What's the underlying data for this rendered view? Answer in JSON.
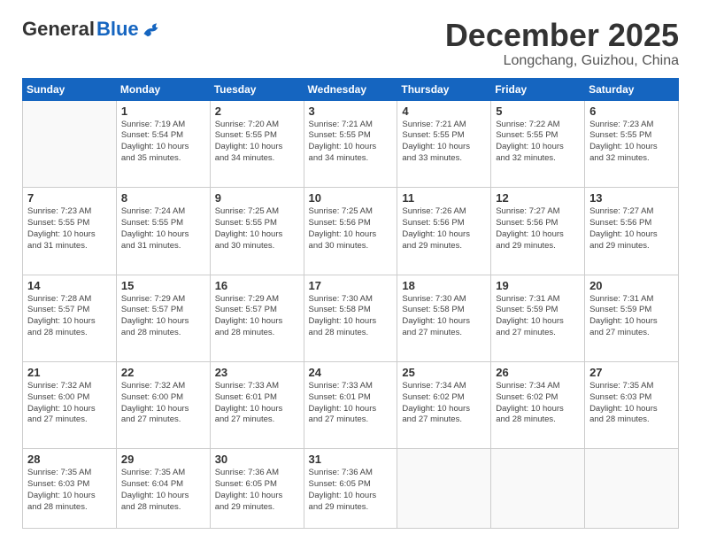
{
  "header": {
    "logo_general": "General",
    "logo_blue": "Blue",
    "month": "December 2025",
    "location": "Longchang, Guizhou, China"
  },
  "days_of_week": [
    "Sunday",
    "Monday",
    "Tuesday",
    "Wednesday",
    "Thursday",
    "Friday",
    "Saturday"
  ],
  "weeks": [
    [
      {
        "day": "",
        "info": ""
      },
      {
        "day": "1",
        "info": "Sunrise: 7:19 AM\nSunset: 5:54 PM\nDaylight: 10 hours\nand 35 minutes."
      },
      {
        "day": "2",
        "info": "Sunrise: 7:20 AM\nSunset: 5:55 PM\nDaylight: 10 hours\nand 34 minutes."
      },
      {
        "day": "3",
        "info": "Sunrise: 7:21 AM\nSunset: 5:55 PM\nDaylight: 10 hours\nand 34 minutes."
      },
      {
        "day": "4",
        "info": "Sunrise: 7:21 AM\nSunset: 5:55 PM\nDaylight: 10 hours\nand 33 minutes."
      },
      {
        "day": "5",
        "info": "Sunrise: 7:22 AM\nSunset: 5:55 PM\nDaylight: 10 hours\nand 32 minutes."
      },
      {
        "day": "6",
        "info": "Sunrise: 7:23 AM\nSunset: 5:55 PM\nDaylight: 10 hours\nand 32 minutes."
      }
    ],
    [
      {
        "day": "7",
        "info": "Sunrise: 7:23 AM\nSunset: 5:55 PM\nDaylight: 10 hours\nand 31 minutes."
      },
      {
        "day": "8",
        "info": "Sunrise: 7:24 AM\nSunset: 5:55 PM\nDaylight: 10 hours\nand 31 minutes."
      },
      {
        "day": "9",
        "info": "Sunrise: 7:25 AM\nSunset: 5:55 PM\nDaylight: 10 hours\nand 30 minutes."
      },
      {
        "day": "10",
        "info": "Sunrise: 7:25 AM\nSunset: 5:56 PM\nDaylight: 10 hours\nand 30 minutes."
      },
      {
        "day": "11",
        "info": "Sunrise: 7:26 AM\nSunset: 5:56 PM\nDaylight: 10 hours\nand 29 minutes."
      },
      {
        "day": "12",
        "info": "Sunrise: 7:27 AM\nSunset: 5:56 PM\nDaylight: 10 hours\nand 29 minutes."
      },
      {
        "day": "13",
        "info": "Sunrise: 7:27 AM\nSunset: 5:56 PM\nDaylight: 10 hours\nand 29 minutes."
      }
    ],
    [
      {
        "day": "14",
        "info": "Sunrise: 7:28 AM\nSunset: 5:57 PM\nDaylight: 10 hours\nand 28 minutes."
      },
      {
        "day": "15",
        "info": "Sunrise: 7:29 AM\nSunset: 5:57 PM\nDaylight: 10 hours\nand 28 minutes."
      },
      {
        "day": "16",
        "info": "Sunrise: 7:29 AM\nSunset: 5:57 PM\nDaylight: 10 hours\nand 28 minutes."
      },
      {
        "day": "17",
        "info": "Sunrise: 7:30 AM\nSunset: 5:58 PM\nDaylight: 10 hours\nand 28 minutes."
      },
      {
        "day": "18",
        "info": "Sunrise: 7:30 AM\nSunset: 5:58 PM\nDaylight: 10 hours\nand 27 minutes."
      },
      {
        "day": "19",
        "info": "Sunrise: 7:31 AM\nSunset: 5:59 PM\nDaylight: 10 hours\nand 27 minutes."
      },
      {
        "day": "20",
        "info": "Sunrise: 7:31 AM\nSunset: 5:59 PM\nDaylight: 10 hours\nand 27 minutes."
      }
    ],
    [
      {
        "day": "21",
        "info": "Sunrise: 7:32 AM\nSunset: 6:00 PM\nDaylight: 10 hours\nand 27 minutes."
      },
      {
        "day": "22",
        "info": "Sunrise: 7:32 AM\nSunset: 6:00 PM\nDaylight: 10 hours\nand 27 minutes."
      },
      {
        "day": "23",
        "info": "Sunrise: 7:33 AM\nSunset: 6:01 PM\nDaylight: 10 hours\nand 27 minutes."
      },
      {
        "day": "24",
        "info": "Sunrise: 7:33 AM\nSunset: 6:01 PM\nDaylight: 10 hours\nand 27 minutes."
      },
      {
        "day": "25",
        "info": "Sunrise: 7:34 AM\nSunset: 6:02 PM\nDaylight: 10 hours\nand 27 minutes."
      },
      {
        "day": "26",
        "info": "Sunrise: 7:34 AM\nSunset: 6:02 PM\nDaylight: 10 hours\nand 28 minutes."
      },
      {
        "day": "27",
        "info": "Sunrise: 7:35 AM\nSunset: 6:03 PM\nDaylight: 10 hours\nand 28 minutes."
      }
    ],
    [
      {
        "day": "28",
        "info": "Sunrise: 7:35 AM\nSunset: 6:03 PM\nDaylight: 10 hours\nand 28 minutes."
      },
      {
        "day": "29",
        "info": "Sunrise: 7:35 AM\nSunset: 6:04 PM\nDaylight: 10 hours\nand 28 minutes."
      },
      {
        "day": "30",
        "info": "Sunrise: 7:36 AM\nSunset: 6:05 PM\nDaylight: 10 hours\nand 29 minutes."
      },
      {
        "day": "31",
        "info": "Sunrise: 7:36 AM\nSunset: 6:05 PM\nDaylight: 10 hours\nand 29 minutes."
      },
      {
        "day": "",
        "info": ""
      },
      {
        "day": "",
        "info": ""
      },
      {
        "day": "",
        "info": ""
      }
    ]
  ]
}
